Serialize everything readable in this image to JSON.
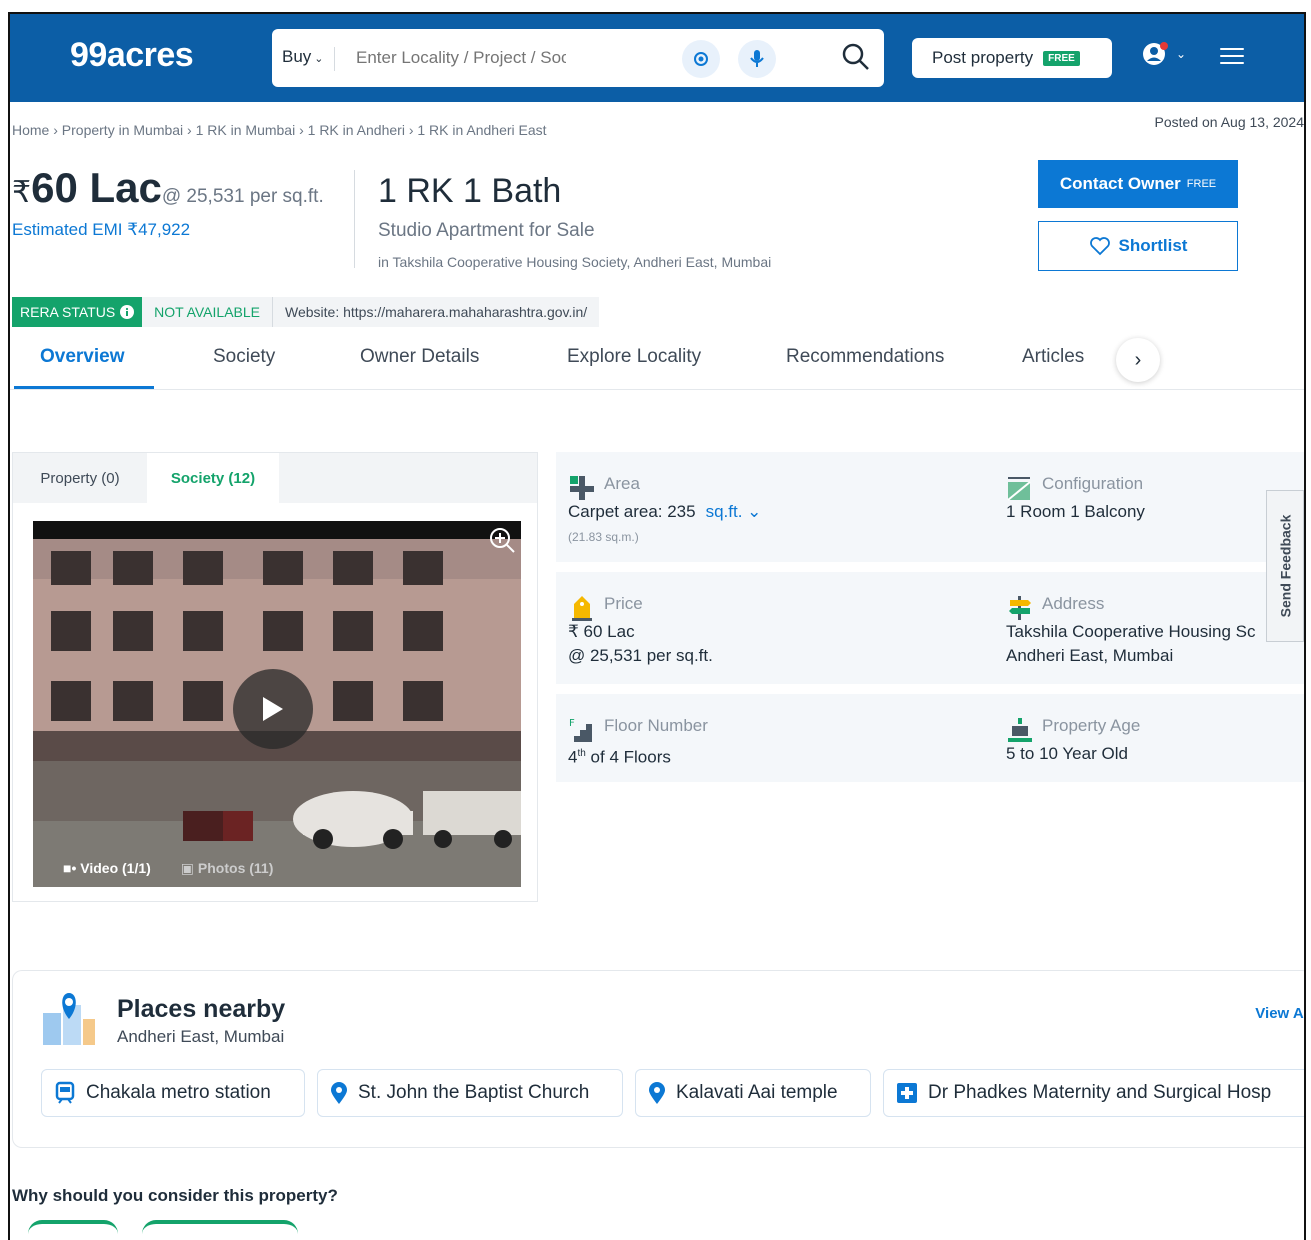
{
  "header": {
    "logo": "99acres",
    "search_mode": "Buy",
    "search_placeholder": "Enter Locality / Project / Society / Lar",
    "post_property": "Post property",
    "post_free": "FREE"
  },
  "breadcrumb": "Home › Property in Mumbai › 1 RK in Mumbai › 1 RK in Andheri › 1 RK in Andheri East",
  "posted": "Posted on Aug 13, 2024",
  "price": {
    "symbol": "₹",
    "value": "60 Lac",
    "per_sqft": "@ 25,531 per sq.ft.",
    "emi": "Estimated EMI ₹47,922"
  },
  "config": {
    "title": "1 RK 1 Bath",
    "subtitle": "Studio Apartment for Sale",
    "location": "in Takshila Cooperative Housing Society, Andheri East, Mumbai"
  },
  "actions": {
    "contact": "Contact Owner",
    "contact_free": "FREE",
    "shortlist": "Shortlist"
  },
  "rera": {
    "label": "RERA STATUS",
    "status": "NOT AVAILABLE",
    "website": "Website: https://maharera.mahaharashtra.gov.in/"
  },
  "tabs": [
    "Overview",
    "Society",
    "Owner Details",
    "Explore Locality",
    "Recommendations",
    "Articles"
  ],
  "gallery": {
    "tab_property": "Property (0)",
    "tab_society": "Society (12)",
    "video": "Video (1/1)",
    "photos": "Photos (11)"
  },
  "info": {
    "area_label": "Area",
    "area_value": "Carpet area: 235",
    "area_unit": "sq.ft.",
    "area_sqm": "(21.83 sq.m.)",
    "config_label": "Configuration",
    "config_value": "1 Room 1 Balcony",
    "price_label": "Price",
    "price_value": "₹ 60 Lac",
    "price_psf": "@ 25,531 per sq.ft.",
    "address_label": "Address",
    "address_line1": "Takshila Cooperative Housing Sc",
    "address_line2": "Andheri East, Mumbai",
    "floor_label": "Floor Number",
    "floor_num": "4",
    "floor_sup": "th",
    "floor_of": "of 4 Floors",
    "age_label": "Property Age",
    "age_value": "5 to 10 Year Old"
  },
  "feedback": "Send Feedback",
  "places": {
    "title": "Places nearby",
    "subtitle": "Andheri East, Mumbai",
    "view_all": "View All",
    "chips": [
      "Chakala metro station",
      "St. John the Baptist Church",
      "Kalavati Aai temple",
      "Dr Phadkes Maternity and Surgical Hosp"
    ]
  },
  "why": "Why should you consider this property?",
  "colors": {
    "brand": "#0c5ea6",
    "accent": "#0c78d4",
    "green": "#14a36b"
  }
}
